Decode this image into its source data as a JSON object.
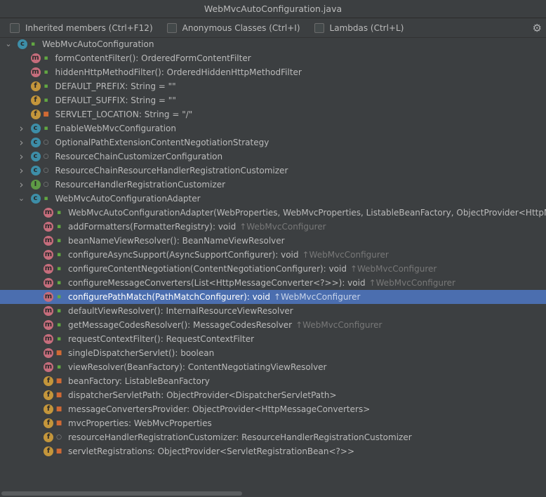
{
  "window": {
    "title": "WebMvcAutoConfiguration.java"
  },
  "toolbar": {
    "checkboxes": [
      {
        "label": "Inherited members (Ctrl+F12)",
        "checked": false
      },
      {
        "label": "Anonymous Classes (Ctrl+I)",
        "checked": false
      },
      {
        "label": "Lambdas (Ctrl+L)",
        "checked": false
      }
    ],
    "settings_icon": "gear-icon"
  },
  "colors": {
    "selection": "#4b6eaf",
    "class": "#3d8ea8",
    "method": "#c66d7c",
    "field": "#c4963b",
    "interface": "#5e9b45"
  },
  "tree": [
    {
      "level": 0,
      "chevron": "expanded",
      "kind": "class",
      "access": "public",
      "text": "WebMvcAutoConfiguration"
    },
    {
      "level": 1,
      "chevron": "none",
      "kind": "method",
      "access": "public",
      "text": "formContentFilter(): OrderedFormContentFilter"
    },
    {
      "level": 1,
      "chevron": "none",
      "kind": "method",
      "access": "public",
      "text": "hiddenHttpMethodFilter(): OrderedHiddenHttpMethodFilter"
    },
    {
      "level": 1,
      "chevron": "none",
      "kind": "field",
      "access": "public",
      "text": "DEFAULT_PREFIX: String = \"\""
    },
    {
      "level": 1,
      "chevron": "none",
      "kind": "field",
      "access": "public",
      "text": "DEFAULT_SUFFIX: String = \"\""
    },
    {
      "level": 1,
      "chevron": "none",
      "kind": "field",
      "access": "private",
      "text": "SERVLET_LOCATION: String = \"/\""
    },
    {
      "level": 1,
      "chevron": "collapsed",
      "kind": "class",
      "access": "public",
      "text": "EnableWebMvcConfiguration"
    },
    {
      "level": 1,
      "chevron": "collapsed",
      "kind": "class",
      "access": "package",
      "text": "OptionalPathExtensionContentNegotiationStrategy"
    },
    {
      "level": 1,
      "chevron": "collapsed",
      "kind": "class",
      "access": "package",
      "text": "ResourceChainCustomizerConfiguration"
    },
    {
      "level": 1,
      "chevron": "collapsed",
      "kind": "class",
      "access": "package",
      "text": "ResourceChainResourceHandlerRegistrationCustomizer"
    },
    {
      "level": 1,
      "chevron": "collapsed",
      "kind": "interface",
      "access": "package",
      "text": "ResourceHandlerRegistrationCustomizer"
    },
    {
      "level": 1,
      "chevron": "expanded",
      "kind": "class",
      "access": "public",
      "text": "WebMvcAutoConfigurationAdapter"
    },
    {
      "level": 2,
      "chevron": "none",
      "kind": "method",
      "access": "public",
      "text": "WebMvcAutoConfigurationAdapter(WebProperties, WebMvcProperties, ListableBeanFactory, ObjectProvider<HttpMessageConverters>"
    },
    {
      "level": 2,
      "chevron": "none",
      "kind": "method",
      "access": "public",
      "text": "addFormatters(FormatterRegistry): void",
      "inherited": "↑WebMvcConfigurer"
    },
    {
      "level": 2,
      "chevron": "none",
      "kind": "method",
      "access": "public",
      "text": "beanNameViewResolver(): BeanNameViewResolver"
    },
    {
      "level": 2,
      "chevron": "none",
      "kind": "method",
      "access": "public",
      "text": "configureAsyncSupport(AsyncSupportConfigurer): void",
      "inherited": "↑WebMvcConfigurer"
    },
    {
      "level": 2,
      "chevron": "none",
      "kind": "method",
      "access": "public",
      "text": "configureContentNegotiation(ContentNegotiationConfigurer): void",
      "inherited": "↑WebMvcConfigurer"
    },
    {
      "level": 2,
      "chevron": "none",
      "kind": "method",
      "access": "public",
      "text": "configureMessageConverters(List<HttpMessageConverter<?>>): void",
      "inherited": "↑WebMvcConfigurer"
    },
    {
      "level": 2,
      "chevron": "none",
      "kind": "method",
      "access": "public",
      "text": "configurePathMatch(PathMatchConfigurer): void",
      "inherited": "↑WebMvcConfigurer",
      "selected": true
    },
    {
      "level": 2,
      "chevron": "none",
      "kind": "method",
      "access": "public",
      "text": "defaultViewResolver(): InternalResourceViewResolver"
    },
    {
      "level": 2,
      "chevron": "none",
      "kind": "method",
      "access": "public",
      "text": "getMessageCodesResolver(): MessageCodesResolver",
      "inherited": "↑WebMvcConfigurer"
    },
    {
      "level": 2,
      "chevron": "none",
      "kind": "method",
      "access": "public",
      "text": "requestContextFilter(): RequestContextFilter"
    },
    {
      "level": 2,
      "chevron": "none",
      "kind": "method",
      "access": "private",
      "text": "singleDispatcherServlet(): boolean"
    },
    {
      "level": 2,
      "chevron": "none",
      "kind": "method",
      "access": "public",
      "text": "viewResolver(BeanFactory): ContentNegotiatingViewResolver"
    },
    {
      "level": 2,
      "chevron": "none",
      "kind": "field",
      "access": "private",
      "text": "beanFactory: ListableBeanFactory"
    },
    {
      "level": 2,
      "chevron": "none",
      "kind": "field",
      "access": "private",
      "text": "dispatcherServletPath: ObjectProvider<DispatcherServletPath>"
    },
    {
      "level": 2,
      "chevron": "none",
      "kind": "field",
      "access": "private",
      "text": "messageConvertersProvider: ObjectProvider<HttpMessageConverters>"
    },
    {
      "level": 2,
      "chevron": "none",
      "kind": "field",
      "access": "private",
      "text": "mvcProperties: WebMvcProperties"
    },
    {
      "level": 2,
      "chevron": "none",
      "kind": "field",
      "access": "package",
      "text": "resourceHandlerRegistrationCustomizer: ResourceHandlerRegistrationCustomizer"
    },
    {
      "level": 2,
      "chevron": "none",
      "kind": "field",
      "access": "private",
      "text": "servletRegistrations: ObjectProvider<ServletRegistrationBean<?>>"
    }
  ]
}
